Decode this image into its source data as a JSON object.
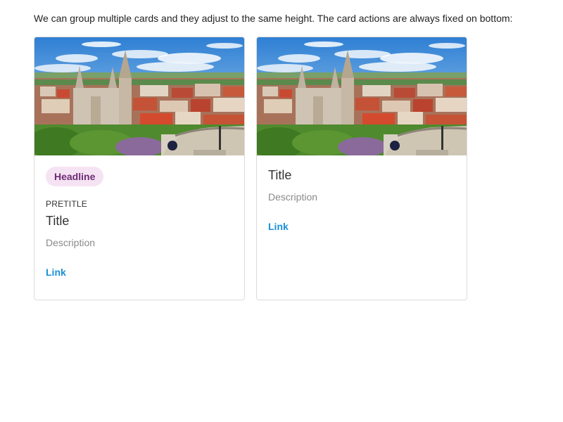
{
  "intro_text": "We can group multiple cards and they adjust to the same height. The card actions are always fixed on bottom:",
  "colors": {
    "chip_background": "#f5e3f4",
    "chip_text": "#6d2b73",
    "link": "#1a8fd6",
    "description": "#8a8a8a",
    "card_border": "#dcdcdc"
  },
  "cards": [
    {
      "image": "city-cathedral-photo",
      "headline_chip": "Headline",
      "pretitle": "PRETITLE",
      "title": "Title",
      "description": "Description",
      "link": "Link"
    },
    {
      "image": "city-cathedral-photo",
      "title": "Title",
      "description": "Description",
      "link": "Link"
    }
  ]
}
